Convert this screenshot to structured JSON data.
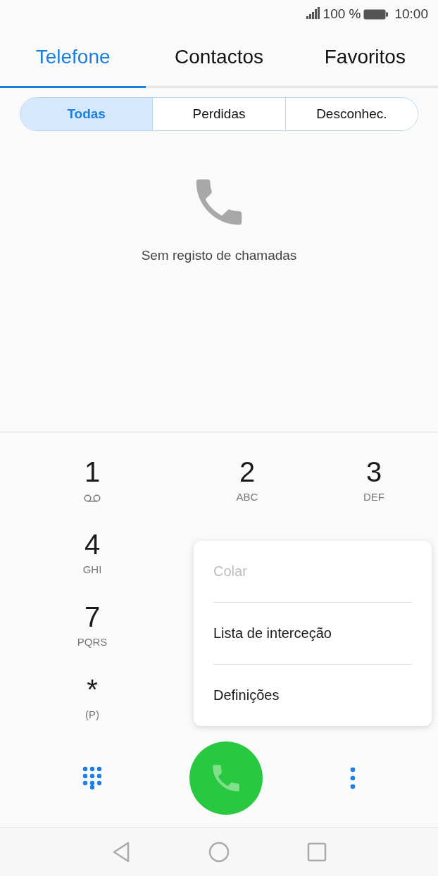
{
  "status_bar": {
    "battery": "100 %",
    "time": "10:00"
  },
  "tabs": [
    {
      "label": "Telefone",
      "selected": true
    },
    {
      "label": "Contactos",
      "selected": false
    },
    {
      "label": "Favoritos",
      "selected": false
    }
  ],
  "filters": [
    {
      "label": "Todas",
      "selected": true
    },
    {
      "label": "Perdidas",
      "selected": false
    },
    {
      "label": "Desconhec.",
      "selected": false
    }
  ],
  "empty_state": {
    "message": "Sem registo de chamadas"
  },
  "keypad": [
    [
      {
        "digit": "1",
        "kind": "voicemail"
      },
      {
        "digit": "2",
        "kind": "letters",
        "letters": "ABC"
      },
      {
        "digit": "3",
        "kind": "letters",
        "letters": "DEF"
      }
    ],
    [
      {
        "digit": "4",
        "kind": "letters",
        "letters": "GHI"
      }
    ],
    [
      {
        "digit": "7",
        "kind": "letters",
        "letters": "PQRS"
      }
    ],
    [
      {
        "digit": "*",
        "kind": "letters",
        "letters": "(P)"
      }
    ]
  ],
  "menu": [
    {
      "label": "Colar",
      "disabled": true
    },
    {
      "label": "Lista de interceção",
      "disabled": false
    },
    {
      "label": "Definições",
      "disabled": false
    }
  ]
}
